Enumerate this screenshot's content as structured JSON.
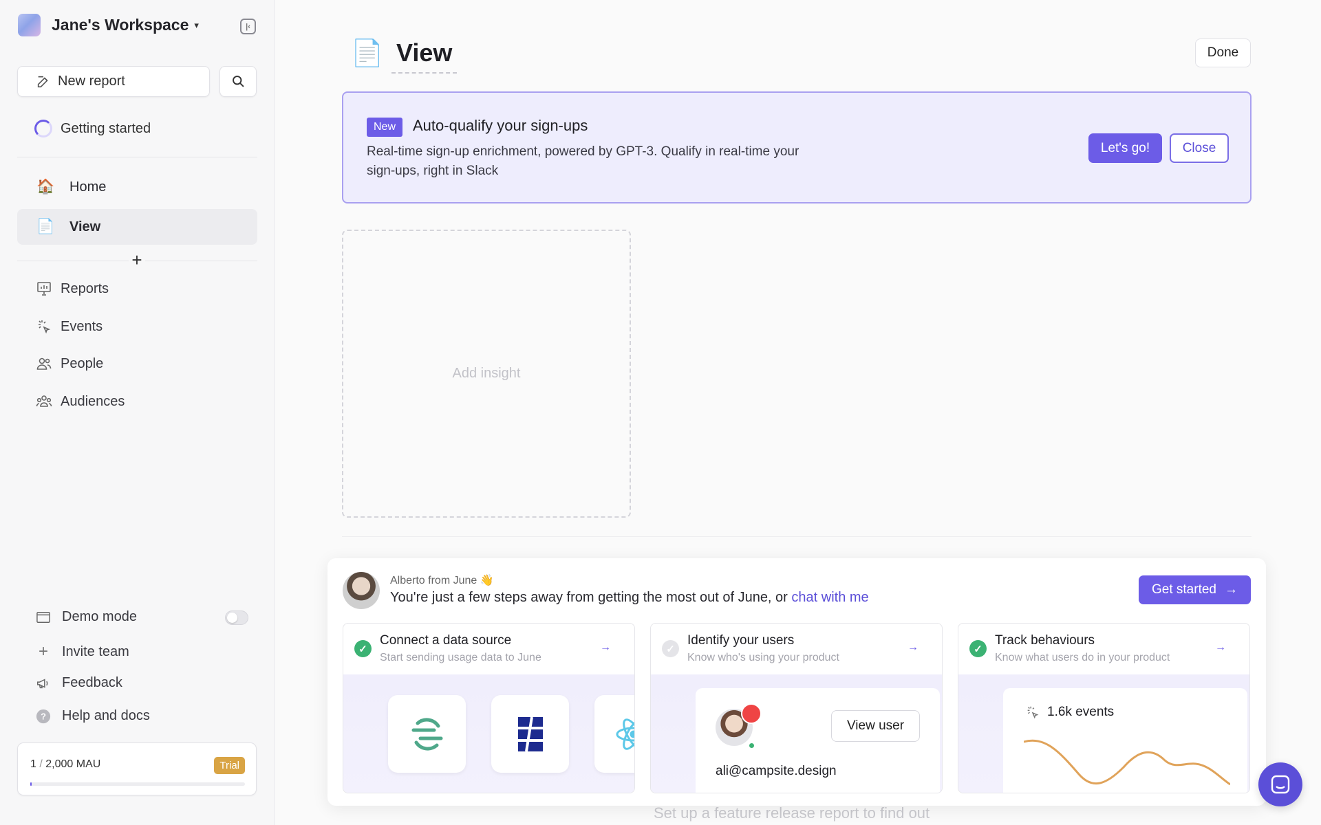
{
  "sidebar": {
    "workspace_name": "Jane's Workspace",
    "new_report_label": "New report",
    "getting_started_label": "Getting started",
    "pinned": [
      {
        "label": "Home",
        "icon": "house-emoji",
        "emoji": "🏠"
      },
      {
        "label": "View",
        "icon": "page-emoji",
        "emoji": "📄",
        "active": true
      }
    ],
    "nav": [
      {
        "label": "Reports",
        "icon": "presentation-chart-icon"
      },
      {
        "label": "Events",
        "icon": "cursor-click-icon"
      },
      {
        "label": "People",
        "icon": "users-icon"
      },
      {
        "label": "Audiences",
        "icon": "group-icon"
      }
    ],
    "bottom": [
      {
        "label": "Demo mode",
        "icon": "window-icon"
      },
      {
        "label": "Invite team",
        "icon": "plus-icon"
      },
      {
        "label": "Feedback",
        "icon": "megaphone-icon"
      },
      {
        "label": "Help and docs",
        "icon": "help-icon"
      }
    ],
    "demo_mode_on": false,
    "mau": {
      "used": "1",
      "limit": "2,000 MAU",
      "separator": "/",
      "badge": "Trial",
      "progress": 0.0005
    }
  },
  "main": {
    "title": "View",
    "done_label": "Done",
    "banner": {
      "badge": "New",
      "title": "Auto-qualify your sign-ups",
      "description": "Real-time sign-up enrichment, powered by GPT-3. Qualify in real-time your sign-ups, right in Slack",
      "cta": "Let's go!",
      "close": "Close"
    },
    "add_insight_label": "Add insight",
    "onboarding": {
      "from": "Alberto from June 👋",
      "message": "You're just a few steps away from getting the most out of June, or ",
      "link": "chat with me",
      "cta": "Get started",
      "steps": [
        {
          "title": "Connect a data source",
          "subtitle": "Start sending usage data to June",
          "done": true
        },
        {
          "title": "Identify your users",
          "subtitle": "Know who's using your product",
          "done": false,
          "preview": {
            "button": "View user",
            "email": "ali@campsite.design"
          }
        },
        {
          "title": "Track behaviours",
          "subtitle": "Know what users do in your product",
          "done": true,
          "preview": {
            "label": "1.6k events"
          }
        }
      ]
    },
    "ghost_text": "Set up a feature release report to find out"
  },
  "colors": {
    "accent": "#6c5ce7",
    "success": "#3bb273",
    "trial": "#d9a444"
  }
}
